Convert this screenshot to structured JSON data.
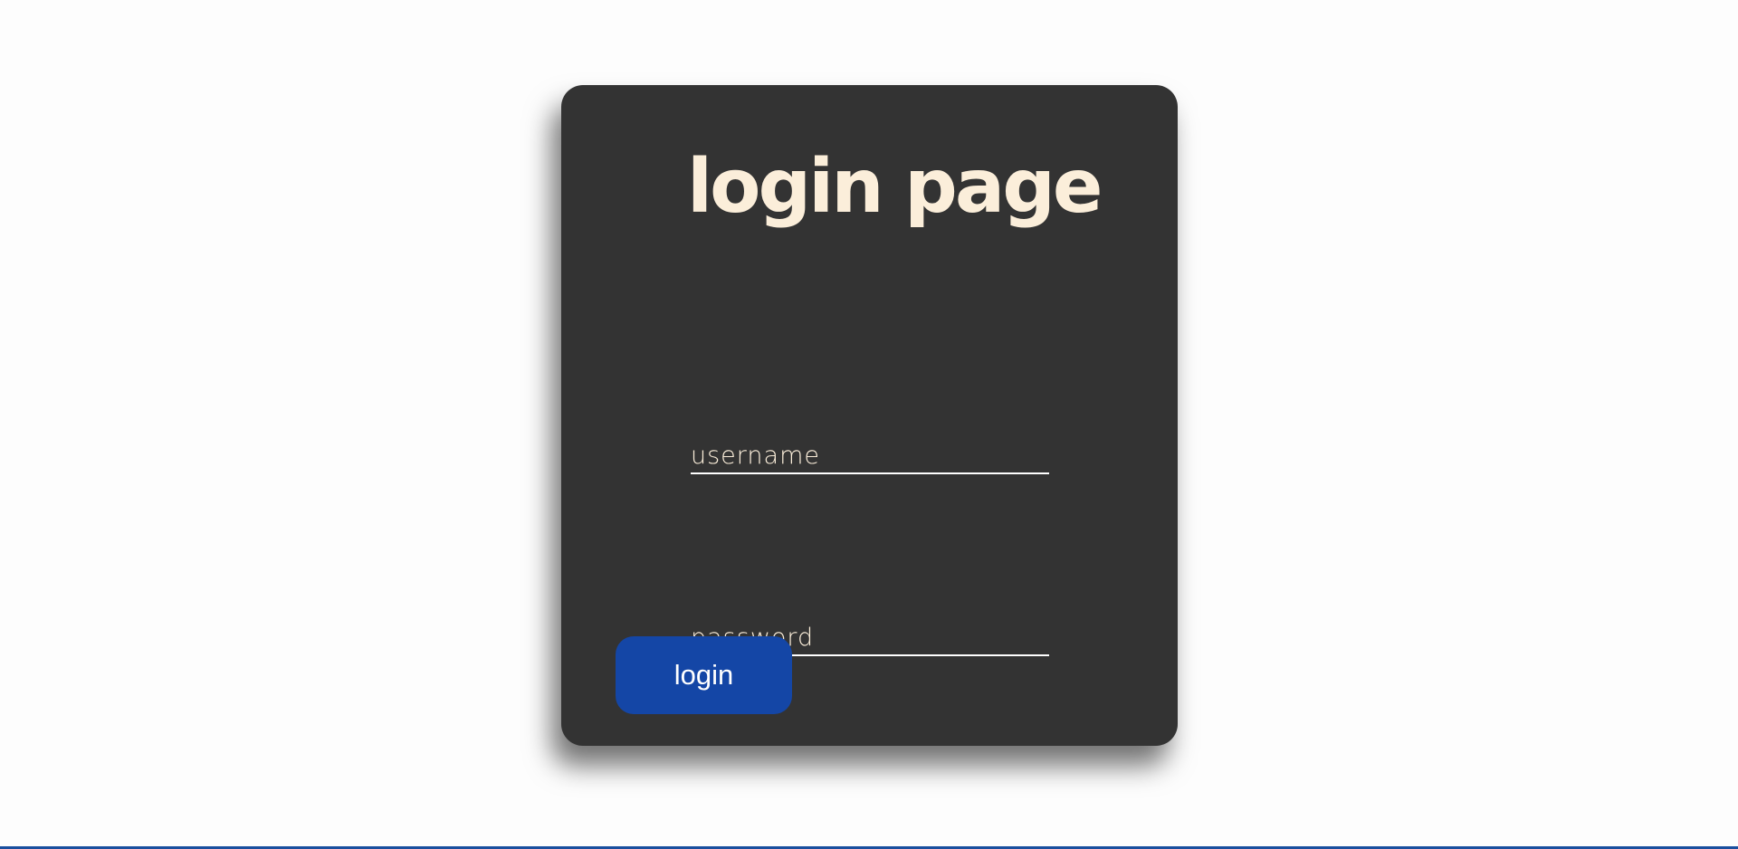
{
  "login_form": {
    "title": "login page",
    "username_placeholder": "username",
    "password_placeholder": "password",
    "login_label": "login"
  },
  "colors": {
    "page_background": "#fdfdfd",
    "card_background": "#333333",
    "title_color": "#fbeeda",
    "button_color": "#1446a6",
    "accent_line": "#1a4f9e"
  }
}
